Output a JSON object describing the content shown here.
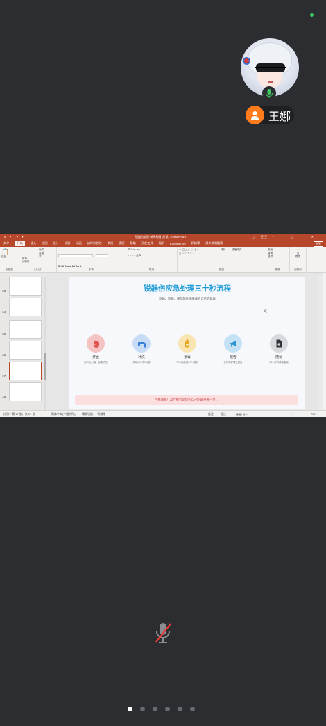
{
  "participant": {
    "name": "王娜",
    "mic_state": "speaking"
  },
  "ppt": {
    "window_title": "锐器伤处理·新闻动画 [只读] - PowerPoint",
    "user": "王 王",
    "tabs": [
      "文件",
      "开始",
      "插入",
      "绘图",
      "设计",
      "切换",
      "动画",
      "幻灯片放映",
      "审阅",
      "视图",
      "帮助",
      "开发工具",
      "福昕",
      "EndNote X9",
      "网格课",
      "操作说明搜索"
    ],
    "active_tab": "开始",
    "share": "共享",
    "ribbon_groups": [
      "剪贴板",
      "幻灯片",
      "字体",
      "段落",
      "绘图",
      "编辑",
      "加载项"
    ],
    "ribbon": {
      "paste": "粘贴",
      "new_slide": "新建\n幻灯片",
      "layout": "版式",
      "reset": "重置",
      "section": "节",
      "arrange": "排列",
      "quick_style": "快速样式",
      "find": "查找",
      "replace": "替换",
      "select": "选择",
      "addin": "加\n载项"
    },
    "thumbnails": [
      {
        "num": "13"
      },
      {
        "num": "14"
      },
      {
        "num": "15"
      },
      {
        "num": "16"
      },
      {
        "num": "17",
        "selected": true
      },
      {
        "num": "18"
      }
    ],
    "slide": {
      "title": "锐器伤应急处理三十秒流程",
      "subtitle": "冷静、迅速、规范的处理能保护自己的健康",
      "steps": [
        {
          "title": "挤血",
          "desc": "伤口近心端，轻柔挤压",
          "color": "#f6c3c3",
          "icon": "hand-icon",
          "icon_color": "#e2554f"
        },
        {
          "title": "冲洗",
          "desc": "流动水冲洗5分钟",
          "color": "#c9dcf6",
          "icon": "faucet-icon",
          "icon_color": "#3b7fd6"
        },
        {
          "title": "消毒",
          "desc": "75%酒精或0.5%碘伏",
          "color": "#f9e5b2",
          "icon": "bottle-icon",
          "icon_color": "#e7a91f"
        },
        {
          "title": "报告",
          "desc": "及时向护理长报告",
          "color": "#c5e2f4",
          "icon": "megaphone-icon",
          "icon_color": "#2e95d0"
        },
        {
          "title": "随访",
          "desc": "24小时内填报备案",
          "color": "#d8d9dd",
          "icon": "document-icon",
          "icon_color": "#2f3338"
        }
      ],
      "banner": "严格遵循！及时报告是保护自己的最重要一步。"
    },
    "status": {
      "slide_info": "幻灯片 第 17 张，共 21 张",
      "language": "简体中文(中国大陆)",
      "accessibility": "辅助功能: 一切就绪",
      "notes": "备注",
      "comments": "批注",
      "zoom": "73%"
    }
  },
  "dots": {
    "count": 6,
    "active": 0
  }
}
